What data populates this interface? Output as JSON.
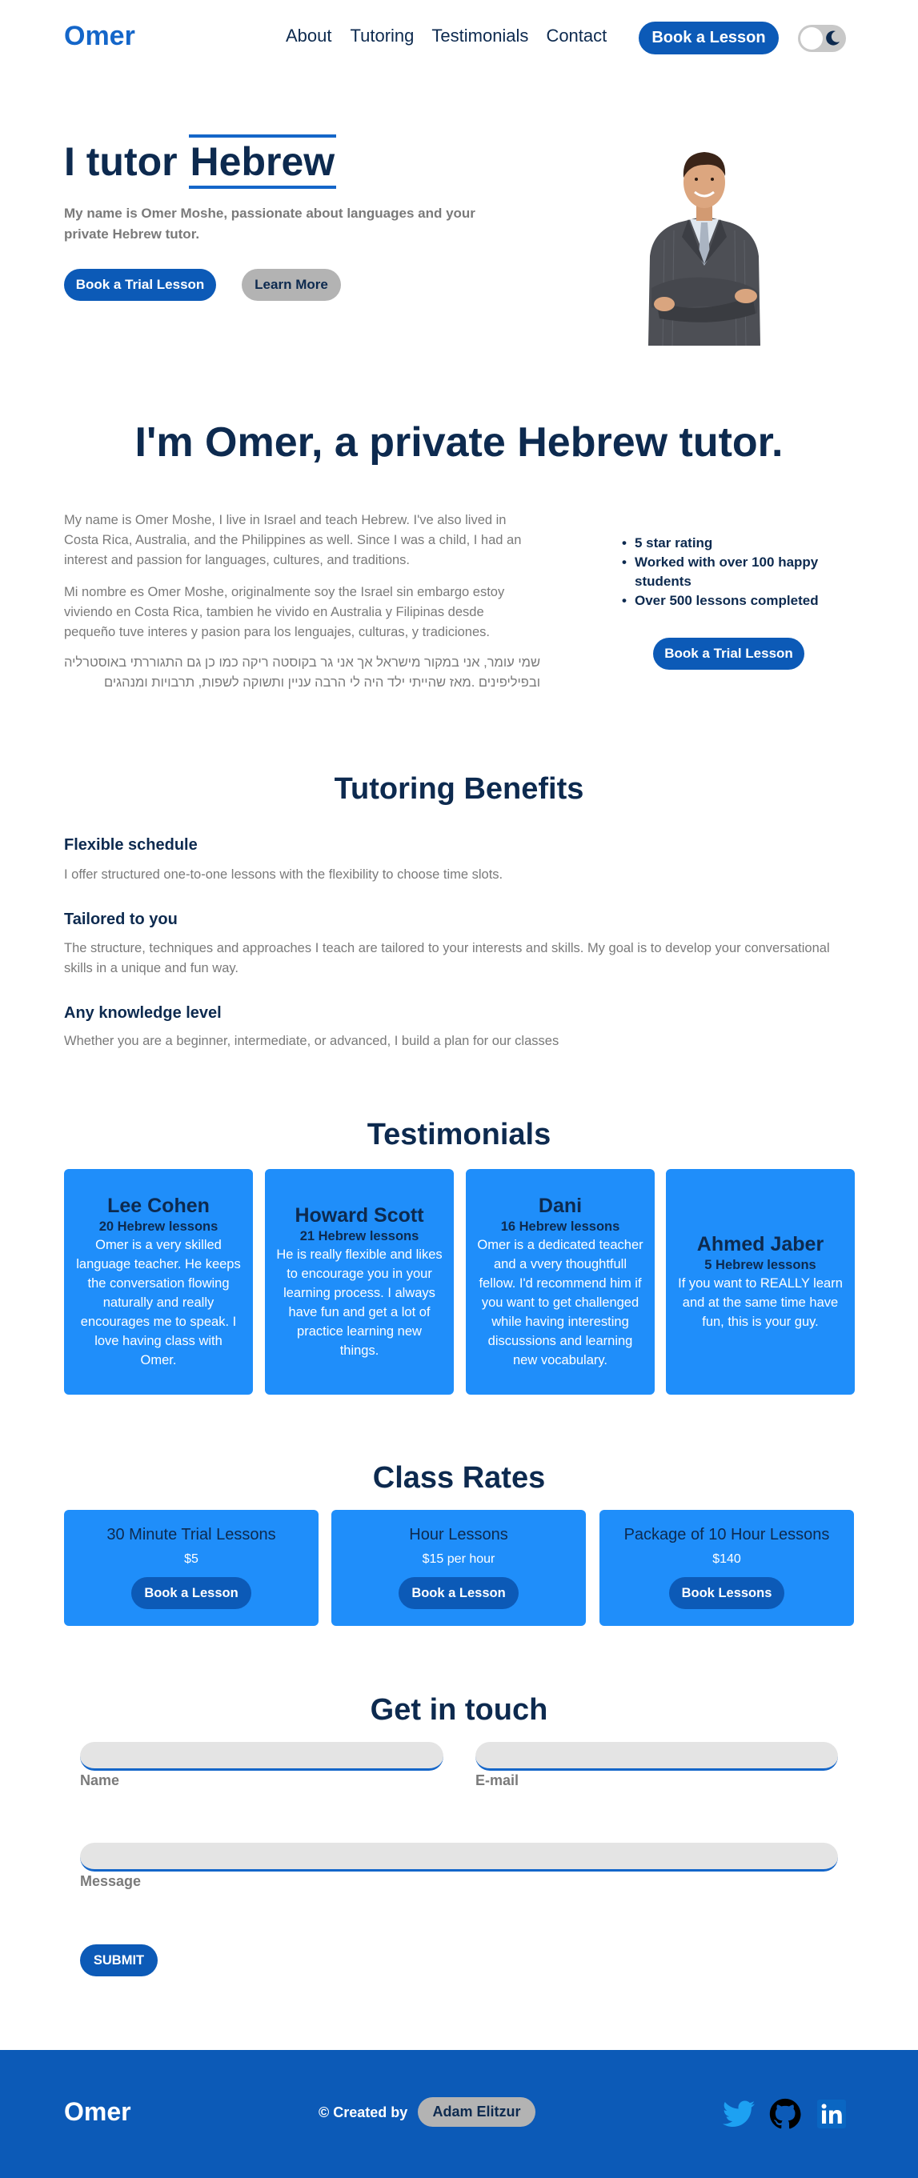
{
  "nav": {
    "logo": "Omer",
    "links": [
      "About",
      "Tutoring",
      "Testimonials",
      "Contact"
    ],
    "book_label": "Book a Lesson",
    "theme_toggle_icon": "moon-icon"
  },
  "hero": {
    "title_prefix": "I tutor",
    "title_highlight": "Hebrew",
    "subtitle": "My name is Omer Moshe, passionate about languages and your private Hebrew tutor.",
    "trial_button": "Book a Trial Lesson",
    "learn_button": "Learn More"
  },
  "about": {
    "title": "I'm Omer, a private Hebrew tutor.",
    "paragraph_en": "My name is Omer Moshe, I live in Israel and teach Hebrew. I've also lived in Costa Rica, Australia, and the Philippines as well. Since I was a child, I had an interest and passion for languages, cultures, and traditions.",
    "paragraph_es": "Mi nombre es Omer Moshe, originalmente soy the Israel sin embargo estoy viviendo en Costa Rica, tambien he vivido en Australia y Filipinas desde pequeño tuve interes y pasion para los lenguajes, culturas, y tradiciones.",
    "paragraph_he": "שמי עומר, אני במקור מישראל אך אני גר בקוסטה ריקה כמו כן גם התגוררתי באוסטרליה ובפיליפינים .מאז שהייתי ילד היה לי הרבה עניין ותשוקה לשפות, תרבויות ומנהגים",
    "highlights": [
      "5 star rating",
      "Worked with over 100 happy students",
      "Over 500 lessons completed"
    ],
    "button": "Book a Trial Lesson"
  },
  "benefits": {
    "title": "Tutoring Benefits",
    "items": [
      {
        "heading": "Flexible schedule",
        "text": "I offer structured one-to-one lessons with the flexibility to choose time slots."
      },
      {
        "heading": "Tailored to you",
        "text": "The structure, techniques and approaches I teach are tailored to your interests and skills. My goal is to develop your conversational skills in a unique and fun way."
      },
      {
        "heading": "Any knowledge level",
        "text": "Whether you are a beginner, intermediate, or advanced, I build a plan for our classes"
      }
    ]
  },
  "testimonials": {
    "title": "Testimonials",
    "items": [
      {
        "name": "Lee Cohen",
        "count": "20 Hebrew lessons",
        "text": "Omer is a very skilled language teacher. He keeps the conversation flowing naturally and really encourages me to speak. I love having class with Omer."
      },
      {
        "name": "Howard Scott",
        "count": "21 Hebrew lessons",
        "text": "He is really flexible and likes to encourage you in your learning process. I always have fun and get a lot of practice learning new things."
      },
      {
        "name": "Dani",
        "count": "16 Hebrew lessons",
        "text": "Omer is a dedicated teacher and a vvery thoughtfull fellow. I'd recommend him if you want to get challenged while having interesting discussions and learning new vocabulary."
      },
      {
        "name": "Ahmed Jaber",
        "count": "5 Hebrew lessons",
        "text": "If you want to REALLY learn and at the same time have fun, this is your guy."
      }
    ]
  },
  "rates": {
    "title": "Class Rates",
    "items": [
      {
        "name": "30 Minute Trial Lessons",
        "price": "$5",
        "button": "Book a Lesson"
      },
      {
        "name": "Hour Lessons",
        "price": "$15 per hour",
        "button": "Book a Lesson"
      },
      {
        "name": "Package of 10 Hour Lessons",
        "price": "$140",
        "button": "Book Lessons"
      }
    ]
  },
  "contact": {
    "title": "Get in touch",
    "name_label": "Name",
    "email_label": "E-mail",
    "message_label": "Message",
    "submit": "SUBMIT"
  },
  "footer": {
    "logo": "Omer",
    "credit": "© Created by",
    "author": "Adam Elitzur",
    "icons": [
      "twitter-icon",
      "github-icon",
      "linkedin-icon"
    ]
  },
  "colors": {
    "primary": "#0c5ab7",
    "card": "#1f8efa",
    "heading": "#0d2a4f",
    "muted": "#7a7a7a"
  }
}
